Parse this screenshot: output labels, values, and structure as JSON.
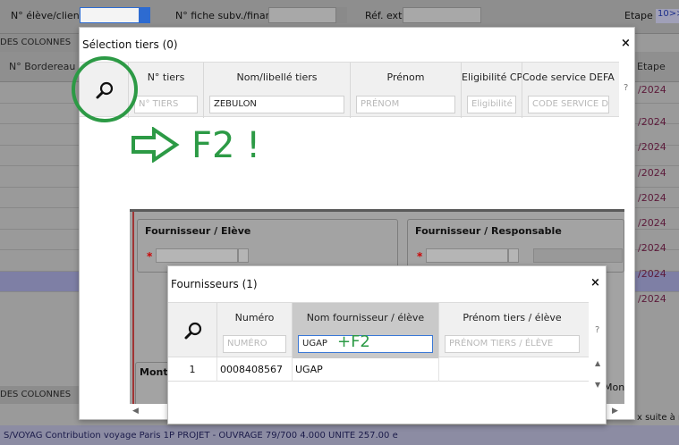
{
  "app": {
    "filters": {
      "eleve_label": "N° élève/client",
      "fiche_label": "N° fiche subv./financ.",
      "ref_label": "Réf. ext.",
      "etape_label": "Etape",
      "etape_value": "10>>"
    },
    "columns_btn": "DES COLONNES",
    "columns_btn_bottom": "DES COLONNES",
    "head_bordereau": "N° Bordereau",
    "head_etape": "Etape",
    "dates": [
      "/2024",
      "/2024",
      "/2024",
      "/2024",
      "/2024",
      "/2024",
      "/2024",
      "/2024",
      "/2024",
      "/2024"
    ],
    "bottom_text": "S/VOYAG   Contribution voyage Paris   1P   PROJET - OUVRAGE   79/700   4.000  UNITE   257.00 e",
    "right_text": "x suite à r"
  },
  "modal1": {
    "title": "Sélection tiers",
    "count": "(0)",
    "close": "×",
    "columns": [
      {
        "header": "N° tiers",
        "value": "",
        "placeholder": "N° TIERS"
      },
      {
        "header": "Nom/libellé tiers",
        "value": "ZEBULON",
        "placeholder": ""
      },
      {
        "header": "Prénom",
        "value": "",
        "placeholder": "PRÉNOM"
      },
      {
        "header": "Eligibilité CPF",
        "value": "",
        "placeholder": "Eligibilité CPF"
      },
      {
        "header": "Code service DEFAU",
        "value": "",
        "placeholder": "CODE SERVICE D"
      }
    ],
    "help": "?",
    "annotation": "F2 !"
  },
  "inner": {
    "fournisseur_eleve": "Fournisseur / Elève",
    "fournisseur_resp": "Fournisseur / Responsable",
    "mon_left": "Mont",
    "mon_right": "Mont"
  },
  "modal2": {
    "title": "Fournisseurs",
    "count": "(1)",
    "close": "×",
    "columns": [
      {
        "header": "Numéro",
        "value": "",
        "placeholder": "NUMÉRO"
      },
      {
        "header": "Nom fournisseur / élève",
        "value": "UGAP",
        "placeholder": ""
      },
      {
        "header": "Prénom tiers / élève",
        "value": "",
        "placeholder": "PRÉNOM TIERS / ÉLÈVE"
      }
    ],
    "row": {
      "index": "1",
      "numero": "0008408567",
      "nom": "UGAP",
      "prenom": ""
    },
    "help": "?",
    "annotation": "+F2"
  },
  "colors": {
    "annotation_green": "#2c9a45",
    "focus_blue": "#3a78d6"
  }
}
